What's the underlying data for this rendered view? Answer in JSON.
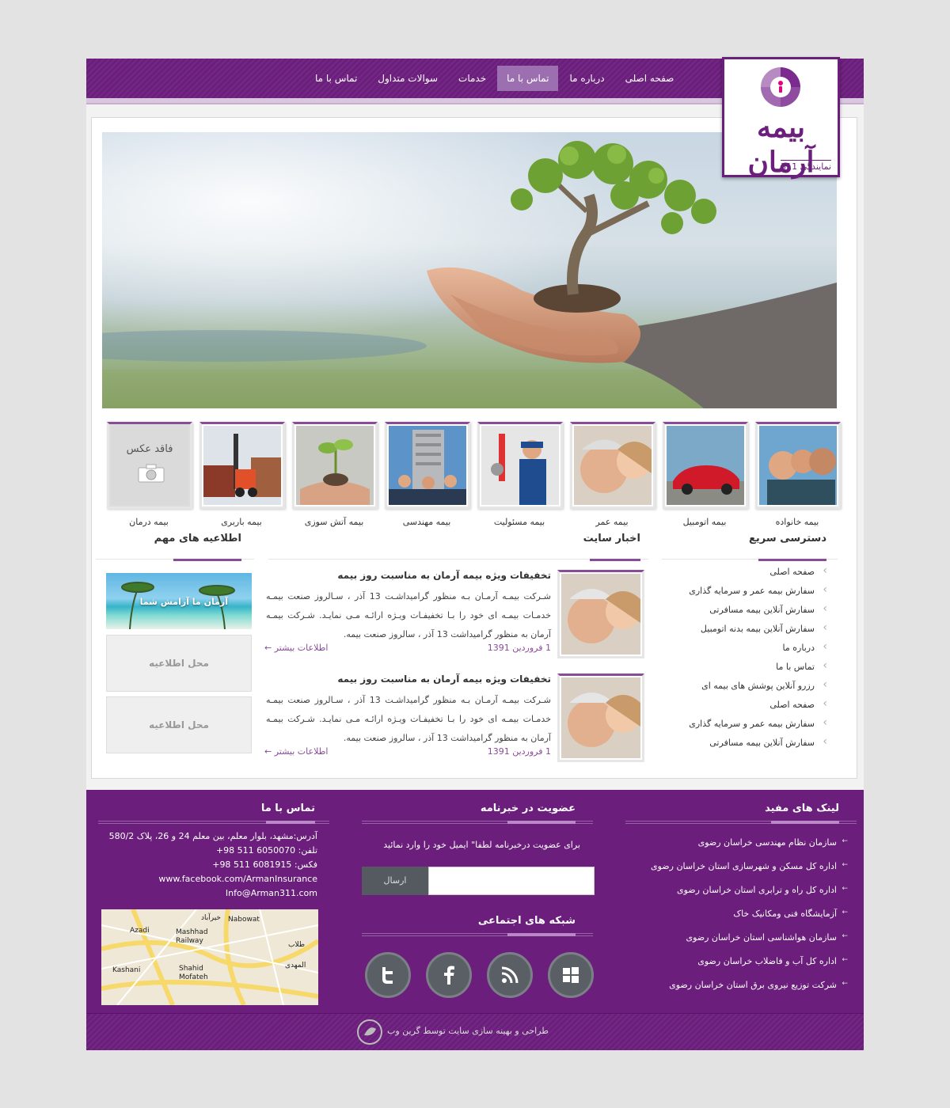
{
  "nav": {
    "items": [
      {
        "label": "صفحه اصلی"
      },
      {
        "label": "درباره ما"
      },
      {
        "label": "تماس با ما"
      },
      {
        "label": "خدمات"
      },
      {
        "label": "سوالات متداول"
      },
      {
        "label": "تماس با ما"
      }
    ],
    "active_index": 2
  },
  "logo": {
    "brand": "بیمه آرمان",
    "subtitle": "نمایندگی 311"
  },
  "services": [
    {
      "label": "بیمه خانواده"
    },
    {
      "label": "بیمه اتومبیل"
    },
    {
      "label": "بیمه عمر"
    },
    {
      "label": "بیمه مسئولیت"
    },
    {
      "label": "بیمه مهندسی"
    },
    {
      "label": "بیمه آتش سوزی"
    },
    {
      "label": "بیمه باربری"
    },
    {
      "label": "بیمه درمان",
      "placeholder": "فاقد عکس"
    }
  ],
  "sections": {
    "quick_access": "دسترسی سریع",
    "news": "اخبار سایت",
    "notices": "اطلاعیه های مهم"
  },
  "quick_links": [
    "صفحه اصلی",
    "سفارش بیمه عمر و سرمایه گذاری",
    "سفارش آنلاین بیمه مسافرتی",
    "سفارش آنلاین بیمه بدنه اتومبیل",
    "درباره ما",
    "تماس با ما",
    "رزرو آنلاین پوشش های بیمه ای",
    "صفحه اصلی",
    "سفارش بیمه عمر و سرمایه گذاری",
    "سفارش آنلاین بیمه مسافرتی"
  ],
  "news": [
    {
      "title": "تخفیفات ویژه بیمه آرمان به مناسبت روز بیمه",
      "body": "شـرکت بیمـه آرمـان بـه منظور گرامیداشـت 13 آذر ، سـالروز صنعت بیمـه خدمـات بیمـه ای خود را بـا تخفیفـات ویـژه ارائـه مـی نمایـد. شـرکت بیمـه آرمان به منظور گرامیداشت 13 آذر ، سالروز صنعت بیمه.",
      "date": "1 فروردین 1391",
      "more": "اطلاعات بیشتر"
    },
    {
      "title": "تخفیفات ویژه بیمه آرمان به مناسبت روز بیمه",
      "body": "شـرکت بیمـه آرمـان بـه منظور گرامیداشـت 13 آذر ، سـالروز صنعت بیمـه خدمـات بیمـه ای خود را بـا تخفیفـات ویـژه ارائـه مـی نمایـد. شـرکت بیمـه آرمان به منظور گرامیداشت 13 آذر ، سالروز صنعت بیمه.",
      "date": "1 فروردین 1391",
      "more": "اطلاعات بیشتر"
    }
  ],
  "notices": {
    "banner_caption": "آرمان ما آرامش شما",
    "slots": [
      "محل اطلاعیه",
      "محل اطلاعیه"
    ]
  },
  "footer": {
    "useful_links_title": "لینک های مفید",
    "useful_links": [
      "سازمان نظام مهندسی خراسان رضوی",
      "اداره کل مسکن و شهرسازی استان خراسان رضوی",
      "اداره کل راه و ترابری استان خراسان رضوی",
      "آزمایشگاه فنی ومکانیک خاک",
      "سازمان هواشناسی استان خراسان رضوی",
      "اداره کل آب و فاضلاب خراسان رضوی",
      "شرکت توزیع نیروی برق استان خراسان رضوی"
    ],
    "newsletter_title": "عضویت در خبرنامه",
    "newsletter_text": "برای عضویت درخبرنامه لطفا\" ایمیل خود را وارد نمائید",
    "newsletter_button": "ارسال",
    "social_title": "شبکه های اجتماعی",
    "social_icons": [
      "windows-icon",
      "rss-icon",
      "facebook-icon",
      "twitter-icon"
    ],
    "contact_title": "تماس با ما",
    "address": "آدرس:مشهد، بلوار معلم، بین معلم 24 و 26، پلاک 580/2",
    "phone": "تلفن: 6050070 511 98+",
    "fax": "فکس: 6081915 511 98+",
    "facebook": "www.facebook.com/ArmanInsurance",
    "email": "Info@Arman311.com",
    "map_labels": [
      "Nabowat",
      "Mashhad Railway",
      "Shahid Mofateh",
      "Kashani",
      "Azadi",
      "خیرآباد",
      "طلاب",
      "المهدی"
    ],
    "copyright": "طراحی و بهینه سازی سایت توسط گرین وب"
  },
  "colors": {
    "brand": "#6b1e7c",
    "accent": "#8a4b99",
    "active_nav": "#9c6fb0"
  }
}
